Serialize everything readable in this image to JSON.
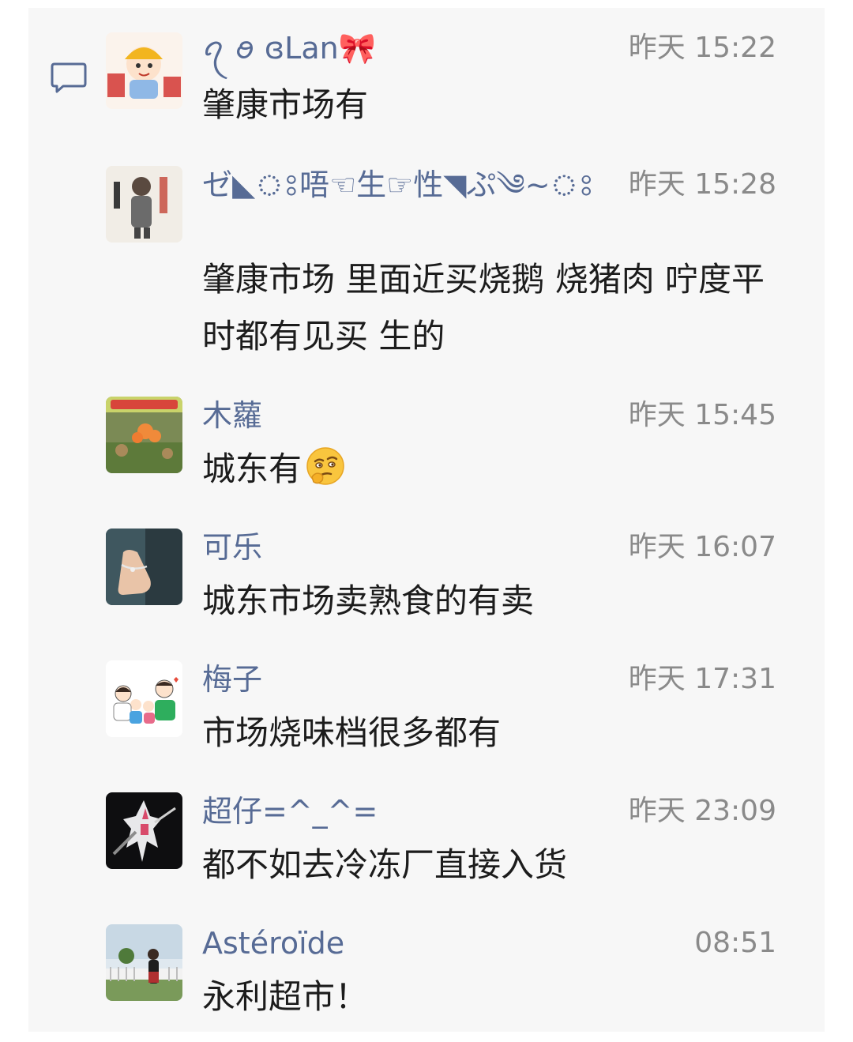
{
  "comments": [
    {
      "name": "ꪖ ꪮ ɞLan🎀",
      "time": "昨天 15:22",
      "text": "肇康市场有"
    },
    {
      "name": "ゼ◣ঃ唔☜生☞性◥ぷ༄~ঃ",
      "time": "昨天 15:28",
      "text": "肇康市场 里面近买烧鹅 烧猪肉 咛度平时都有见买 生的"
    },
    {
      "name": "木蘿",
      "time": "昨天 15:45",
      "text": "城东有",
      "emoji": "thinking-face-emoji"
    },
    {
      "name": "可乐",
      "time": "昨天 16:07",
      "text": "城东市场卖熟食的有卖"
    },
    {
      "name": "梅子",
      "time": "昨天 17:31",
      "text": "市场烧味档很多都有"
    },
    {
      "name": "超仔=^_^=",
      "time": "昨天 23:09",
      "text": "都不如去冷冻厂直接入货"
    },
    {
      "name": "Astéroïde",
      "time": "08:51",
      "text": "永利超市！"
    }
  ],
  "colors": {
    "name": "#576b95",
    "time": "#8a8a8a",
    "text": "#1c1c1c",
    "panel": "#f7f7f7"
  },
  "icons": {
    "comment": "comment-bubble-icon"
  }
}
